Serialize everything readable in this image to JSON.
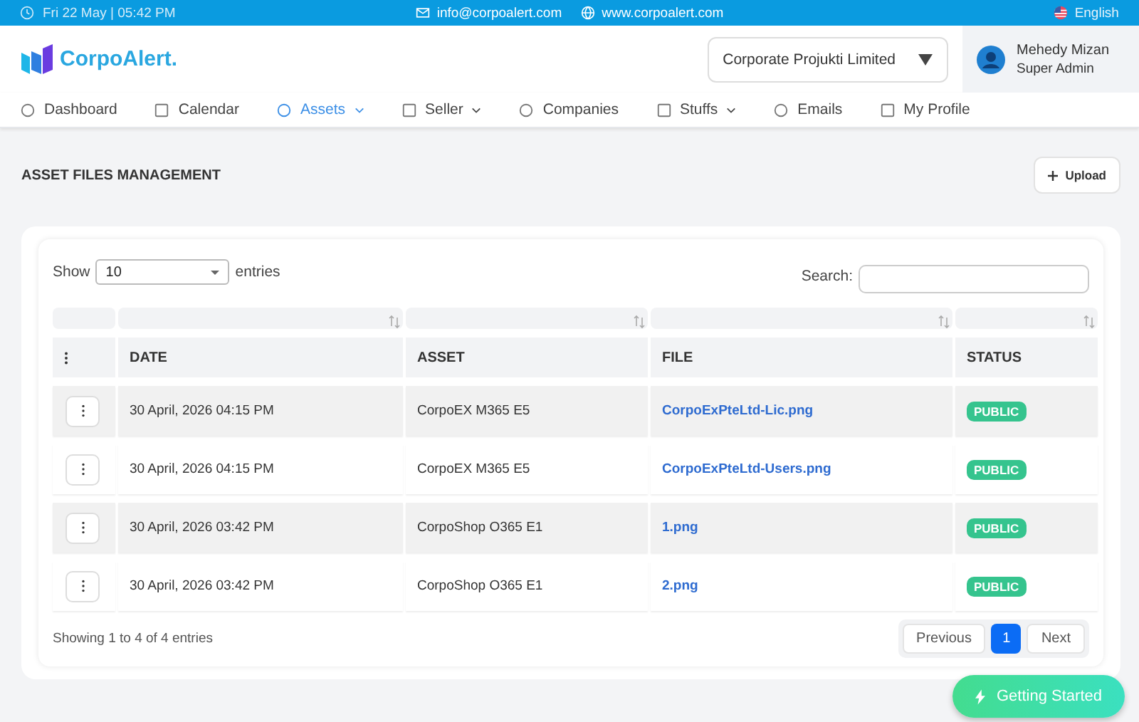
{
  "top_bar": {
    "datetime": "Fri 22 May | 05:42 PM",
    "email": "info@corpoalert.com",
    "website": "www.corpoalert.com",
    "language": "English"
  },
  "header": {
    "logo": "CorpoAlert.",
    "company_select": "Corporate Projukti Limited",
    "user": {
      "name": "Mehedy Mizan",
      "role": "Super Admin"
    }
  },
  "nav": [
    {
      "label": "Dashboard",
      "selected": false,
      "dropdown": false
    },
    {
      "label": "Calendar",
      "selected": false,
      "dropdown": false
    },
    {
      "label": "Assets",
      "selected": true,
      "dropdown": true
    },
    {
      "label": "Seller",
      "selected": false,
      "dropdown": true
    },
    {
      "label": "Companies",
      "selected": false,
      "dropdown": false
    },
    {
      "label": "Stuffs",
      "selected": false,
      "dropdown": true
    },
    {
      "label": "Emails",
      "selected": false,
      "dropdown": false
    },
    {
      "label": "My Profile",
      "selected": false,
      "dropdown": false
    }
  ],
  "page": {
    "title": "ASSET FILES MANAGEMENT",
    "upload_button": "Upload"
  },
  "table": {
    "show_label": "Show",
    "entries_value": "10",
    "entries_label": "entries",
    "search_label": "Search:",
    "columns": [
      "DATE",
      "ASSET",
      "FILE",
      "STATUS"
    ],
    "rows": [
      {
        "date": "30 April, 2026 04:15 PM",
        "asset": "CorpoEX M365 E5",
        "file": "CorpoExPteLtd-Lic.png",
        "status": "PUBLIC"
      },
      {
        "date": "30 April, 2026 04:15 PM",
        "asset": "CorpoEX M365 E5",
        "file": "CorpoExPteLtd-Users.png",
        "status": "PUBLIC"
      },
      {
        "date": "30 April, 2026 03:42 PM",
        "asset": "CorpoShop O365 E1",
        "file": "1.png",
        "status": "PUBLIC"
      },
      {
        "date": "30 April, 2026 03:42 PM",
        "asset": "CorpoShop O365 E1",
        "file": "2.png",
        "status": "PUBLIC"
      }
    ],
    "info": "Showing 1 to 4 of 4 entries",
    "pagination": {
      "previous": "Previous",
      "pages": [
        {
          "label": "1",
          "selected": true
        }
      ],
      "next": "Next"
    }
  },
  "floating_button": "Getting Started"
}
